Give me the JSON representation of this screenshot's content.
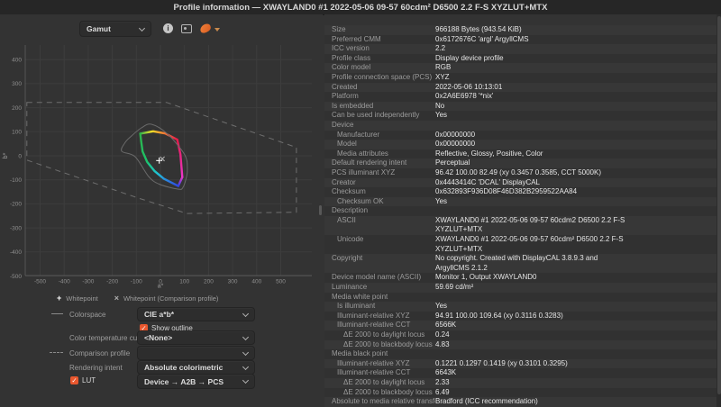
{
  "window": {
    "title": "Profile information — XWAYLAND0 #1 2022-05-06 09-57 60cdm² D6500 2.2 F-S XYZLUT+MTX"
  },
  "toolbar": {
    "view_selector": "Gamut",
    "icons": [
      "info-icon",
      "save-image-icon",
      "color-swatch-icon",
      "chevron-down-icon"
    ]
  },
  "colors": {
    "accent_orange": "#e9572e",
    "panel_bg": "#333333",
    "row_odd": "#373737",
    "row_even": "#313131",
    "titlebar_bg": "#262626"
  },
  "legend": {
    "whitepoint": "Whitepoint",
    "comparison_whitepoint": "Whitepoint (Comparison profile)"
  },
  "controls": {
    "colorspace": {
      "label": "Colorspace",
      "value": "CIE a*b*"
    },
    "show_outline": {
      "label": "Show outline",
      "checked": true
    },
    "color_temperature_curve": {
      "label": "Color temperature curve",
      "value": "<None>"
    },
    "comparison_profile": {
      "label": "Comparison profile",
      "value": ""
    },
    "rendering_intent": {
      "label": "Rendering intent",
      "value": "Absolute colorimetric"
    },
    "lut": {
      "label": "LUT",
      "checked": true,
      "value": "Device → A2B → PCS"
    }
  },
  "chart_data": {
    "type": "line",
    "title": "Gamut",
    "xlabel": "a*",
    "ylabel": "b*",
    "x_ticks": [
      -500,
      -400,
      -300,
      -200,
      -100,
      0,
      100,
      200,
      300,
      400,
      500
    ],
    "y_ticks": [
      400,
      300,
      200,
      100,
      0,
      -100,
      -200,
      -300,
      -400,
      -500
    ],
    "xlim": [
      -585,
      630
    ],
    "ylim": [
      -545,
      470
    ],
    "grid": true,
    "series": [
      {
        "name": "profile-gamut-top-edge",
        "gradient": "grad-top",
        "points": [
          [
            -84,
            92
          ],
          [
            -30,
            102
          ],
          [
            20,
            93
          ],
          [
            70,
            67
          ]
        ]
      },
      {
        "name": "profile-gamut-right-edge",
        "gradient": "grad-right",
        "points": [
          [
            70,
            67
          ],
          [
            83,
            6
          ],
          [
            91,
            -89
          ]
        ]
      },
      {
        "name": "profile-gamut-bottomright-edge",
        "gradient": "grad-br",
        "points": [
          [
            91,
            -89
          ],
          [
            74,
            -126
          ]
        ]
      },
      {
        "name": "profile-gamut-left-edge",
        "gradient": "grad-left",
        "points": [
          [
            -84,
            92
          ],
          [
            -80,
            61
          ],
          [
            -74,
            18
          ],
          [
            -55,
            -26
          ],
          [
            -24,
            -64
          ],
          [
            14,
            -95
          ],
          [
            74,
            -126
          ]
        ]
      },
      {
        "name": "spectral-locus-dashed",
        "stroke": "#6e6e6e",
        "dash": "6 5",
        "closed": true,
        "points": [
          [
            -555,
            222
          ],
          [
            25,
            222
          ],
          [
            565,
            35
          ],
          [
            565,
            -235
          ],
          [
            110,
            -240
          ],
          [
            -95,
            -175
          ],
          [
            -555,
            -18
          ]
        ]
      },
      {
        "name": "gamut-outline-gray",
        "stroke": "#6a6a6a",
        "smooth": true,
        "closed": true,
        "points": [
          [
            -37,
            131
          ],
          [
            30,
            90
          ],
          [
            101,
            4
          ],
          [
            112,
            -55
          ],
          [
            108,
            -90
          ],
          [
            94,
            -131
          ],
          [
            75,
            -139
          ],
          [
            -5,
            -118
          ],
          [
            -49,
            -86
          ],
          [
            -105,
            -4
          ],
          [
            -161,
            19
          ],
          [
            -146,
            56
          ],
          [
            -124,
            79
          ],
          [
            -79,
            116
          ]
        ]
      }
    ],
    "markers": [
      {
        "name": "whitepoint",
        "symbol": "+",
        "a": -5,
        "b": -20,
        "color": "#ffffff"
      },
      {
        "name": "whitepoint-comparison",
        "symbol": "x",
        "a": 8,
        "b": -13,
        "color": "#b0b0b0"
      }
    ]
  },
  "properties": {
    "rows": [
      {
        "label": "Size",
        "value": "966188 Bytes (943.54 KiB)",
        "indent": 0
      },
      {
        "label": "Preferred CMM",
        "value": "0x6172676C 'argl' ArgyllCMS",
        "indent": 0
      },
      {
        "label": "ICC version",
        "value": "2.2",
        "indent": 0
      },
      {
        "label": "Profile class",
        "value": "Display device profile",
        "indent": 0
      },
      {
        "label": "Color model",
        "value": "RGB",
        "indent": 0
      },
      {
        "label": "Profile connection space (PCS)",
        "value": "XYZ",
        "indent": 0
      },
      {
        "label": "Created",
        "value": "2022-05-06 10:13:01",
        "indent": 0
      },
      {
        "label": "Platform",
        "value": "0x2A6E6978 '*nix'",
        "indent": 0
      },
      {
        "label": "Is embedded",
        "value": "No",
        "indent": 0
      },
      {
        "label": "Can be used independently",
        "value": "Yes",
        "indent": 0
      },
      {
        "label": "Device",
        "value": "",
        "indent": 0
      },
      {
        "label": "Manufacturer",
        "value": "0x00000000",
        "indent": 1
      },
      {
        "label": "Model",
        "value": "0x00000000",
        "indent": 1
      },
      {
        "label": "Media attributes",
        "value": "Reflective, Glossy, Positive, Color",
        "indent": 1
      },
      {
        "label": "Default rendering intent",
        "value": "Perceptual",
        "indent": 0
      },
      {
        "label": "PCS illuminant XYZ",
        "value": "96.42 100.00  82.49 (xy 0.3457 0.3585, CCT 5000K)",
        "indent": 0
      },
      {
        "label": "Creator",
        "value": "0x4443414C 'DCAL' DisplayCAL",
        "indent": 0
      },
      {
        "label": "Checksum",
        "value": "0x632893F936D08F46D382B2959522AA84",
        "indent": 0
      },
      {
        "label": "Checksum OK",
        "value": "Yes",
        "indent": 1
      },
      {
        "label": "Description",
        "value": "",
        "indent": 0
      },
      {
        "label": "ASCII",
        "value": "XWAYLAND0 #1 2022-05-06 09-57 60cdm2 D6500 2.2 F-S\nXYZLUT+MTX",
        "indent": 1
      },
      {
        "label": "Unicode",
        "value": "XWAYLAND0 #1 2022-05-06 09-57 60cdm² D6500 2.2 F-S\nXYZLUT+MTX",
        "indent": 1
      },
      {
        "label": "Copyright",
        "value": "No copyright. Created with DisplayCAL 3.8.9.3 and\nArgyllCMS 2.1.2",
        "indent": 0
      },
      {
        "label": "Device model name (ASCII)",
        "value": "Monitor 1, Output XWAYLAND0",
        "indent": 0
      },
      {
        "label": "Luminance",
        "value": "59.69 cd/m²",
        "indent": 0
      },
      {
        "label": "Media white point",
        "value": "",
        "indent": 0
      },
      {
        "label": "Is illuminant",
        "value": "Yes",
        "indent": 1
      },
      {
        "label": "Illuminant-relative XYZ",
        "value": "94.91 100.00 109.64 (xy 0.3116 0.3283)",
        "indent": 1
      },
      {
        "label": "Illuminant-relative CCT",
        "value": "6566K",
        "indent": 1
      },
      {
        "label": "ΔE 2000 to daylight locus",
        "value": "0.24",
        "indent": 2
      },
      {
        "label": "ΔE 2000 to blackbody locus",
        "value": "4.83",
        "indent": 2
      },
      {
        "label": "Media black point",
        "value": "",
        "indent": 0
      },
      {
        "label": "Illuminant-relative XYZ",
        "value": "0.1221 0.1297 0.1419 (xy 0.3101 0.3295)",
        "indent": 1
      },
      {
        "label": "Illuminant-relative CCT",
        "value": "6643K",
        "indent": 1
      },
      {
        "label": "ΔE 2000 to daylight locus",
        "value": "2.33",
        "indent": 2
      },
      {
        "label": "ΔE 2000 to blackbody locus",
        "value": "6.49",
        "indent": 2
      },
      {
        "label": "Absolute to media relative transform",
        "value": "Bradford (ICC recommendation)",
        "indent": 0
      }
    ]
  }
}
